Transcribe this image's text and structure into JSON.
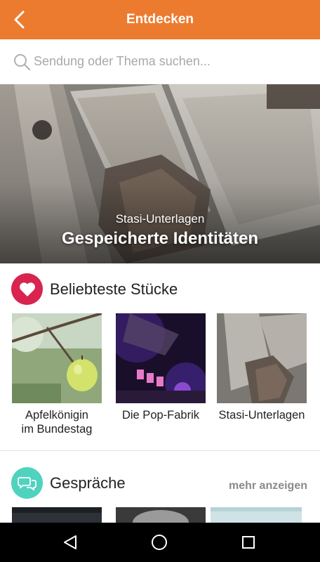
{
  "topbar": {
    "title": "Entdecken",
    "back_icon": "chevron-left-icon",
    "bg": "#ec7b2f"
  },
  "search": {
    "placeholder": "Sendung oder Thema suchen...",
    "value": "",
    "icon": "search-icon"
  },
  "hero": {
    "overline": "Stasi-Unterlagen",
    "title": "Gespeicherte Identitäten"
  },
  "popular": {
    "title": "Beliebteste Stücke",
    "icon": "heart-icon",
    "icon_bg": "#d9244f",
    "cards": [
      {
        "label_line1": "Apfelkönigin",
        "label_line2": "im Bundestag"
      },
      {
        "label_line1": "Die Pop-Fabrik",
        "label_line2": ""
      },
      {
        "label_line1": "Stasi-Unterlagen",
        "label_line2": ""
      }
    ]
  },
  "talks": {
    "title": "Gespräche",
    "icon": "chat-bubbles-icon",
    "icon_bg": "#4fd3be",
    "more_label": "mehr anzeigen"
  },
  "navbar": {
    "back_icon": "nav-back-icon",
    "home_icon": "nav-home-icon",
    "recents_icon": "nav-recents-icon"
  }
}
